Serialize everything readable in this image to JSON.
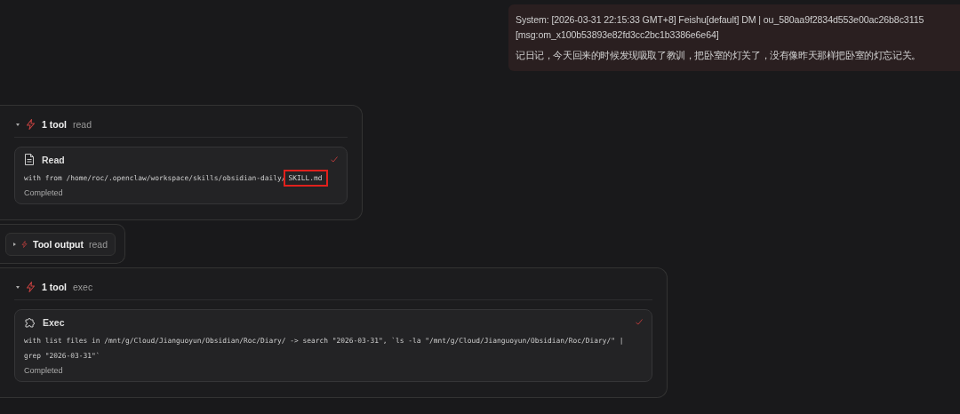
{
  "user_message": {
    "lines": [
      "System: [2026-03-31 22:15:33 GMT+8] Feishu[default] DM | ou_580aa9f2834d553e00ac26b8c3115",
      "[msg:om_x100b53893e82fd3cc2bc1b3386e6e64]"
    ],
    "body": "记日记，今天回来的时候发现吸取了教训，把卧室的灯关了，没有像昨天那样把卧室的灯忘记关。"
  },
  "blocks": [
    {
      "kind": "group",
      "expanded": true,
      "count": "1 tool",
      "tool": "read",
      "card": {
        "kind": "document",
        "name": "Read",
        "done": true,
        "detail": [
          {
            "text": "with from /home/roc/.openclaw/workspace/skills/obsidian-daily/",
            "highlighted": false
          },
          {
            "text": "SKILL.md",
            "highlighted": true
          }
        ],
        "status": "Completed"
      }
    },
    {
      "kind": "output",
      "expanded": false,
      "label": "Tool output",
      "tool": "read"
    },
    {
      "kind": "group",
      "expanded": true,
      "count": "1 tool",
      "tool": "exec",
      "card": {
        "kind": "puzzle",
        "name": "Exec",
        "done": true,
        "detail": [
          {
            "text": "with list files in /mnt/g/Cloud/Jianguoyun/Obsidian/Roc/Diary/ -> search \"2026-03-31\", `ls -la \"/mnt/g/Cloud/Jianguoyun/Obsidian/Roc/Diary/\" | grep \"2026-03-31\"`",
            "highlighted": false
          }
        ],
        "status": "Completed"
      }
    }
  ]
}
